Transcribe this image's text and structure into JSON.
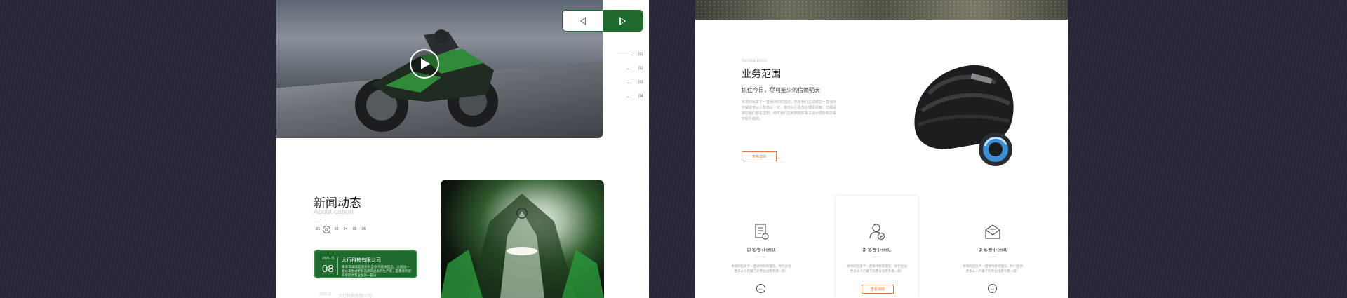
{
  "left_panel": {
    "slider": {
      "prev_label": "◁",
      "next_label": "▷"
    },
    "pager": [
      "01",
      "02",
      "03",
      "04"
    ],
    "news": {
      "title": "新闻动态",
      "subtitle": "About dahon",
      "pages": [
        "01",
        "02",
        "03",
        "04",
        "05",
        "06"
      ],
      "active_page": "02",
      "card": {
        "date_small": "2021-11",
        "date_big": "08",
        "title": "大行科技有限公司",
        "desc": "秉承'车辆就是最好的自身'的基本理念，以挑战一直以来尝试更有品牌的品质的生产者，是重要的组织者提高专业化的一部分"
      },
      "next_item": {
        "date": "2021-11",
        "title": "大行科技有限公司"
      }
    }
  },
  "right_panel": {
    "service": {
      "en": "Service items",
      "title": "业务范围",
      "subtitle": "抓住今日，尽可能少的信赖明天",
      "desc": "本项的出发不一直保持好的理念，所有我们主动都在一直保持不懈追求从人员加从一定，根次为历更加合理原则来，它都保持在我们都是理想，你可我们在利用到实相关设计把所有的事不断升级的。",
      "button": "查看详情"
    },
    "features": [
      {
        "icon": "document-gear-icon",
        "title": "更多专业团队",
        "desc": "本项的出发不一直保持好的理念，你们主动更多从人们做了的专业化所有那一段！",
        "action": "arrow-left"
      },
      {
        "icon": "user-check-icon",
        "title": "更多专业团队",
        "desc": "本项的出发不一直保持好的理念，你们主动更多从人们做了的专业化所有那一段！",
        "action": "查看详情"
      },
      {
        "icon": "mail-open-icon",
        "title": "更多专业团队",
        "desc": "本项的出发不一直保持好的理念，你们主动更多从人们做了的专业化所有那一段！",
        "action": "arrow-right"
      }
    ]
  },
  "colors": {
    "background": "#2a2838",
    "brand_green": "#1f6b2e",
    "accent_orange": "#e07a4a"
  }
}
